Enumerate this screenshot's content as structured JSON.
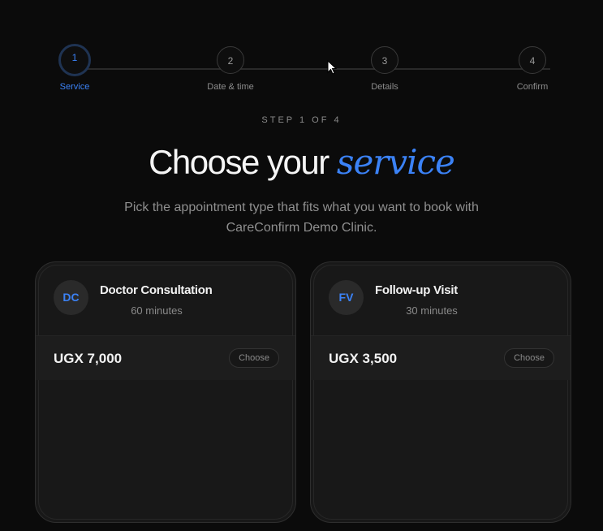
{
  "stepper": {
    "steps": [
      {
        "number": "1",
        "label": "Service"
      },
      {
        "number": "2",
        "label": "Date & time"
      },
      {
        "number": "3",
        "label": "Details"
      },
      {
        "number": "4",
        "label": "Confirm"
      }
    ],
    "active_index": 0
  },
  "header": {
    "eyebrow": "STEP 1 OF 4",
    "title_plain": "Choose your ",
    "title_accent": "service",
    "subtitle": "Pick the appointment type that fits what you want to book with CareConfirm Demo Clinic."
  },
  "services": [
    {
      "initials": "DC",
      "name": "Doctor Consultation",
      "duration": "60 minutes",
      "price": "UGX 7,000",
      "button": "Choose"
    },
    {
      "initials": "FV",
      "name": "Follow-up Visit",
      "duration": "30 minutes",
      "price": "UGX 3,500",
      "button": "Choose"
    }
  ],
  "colors": {
    "accent": "#3b82f6",
    "background": "#0b0b0b",
    "card": "#181818"
  }
}
